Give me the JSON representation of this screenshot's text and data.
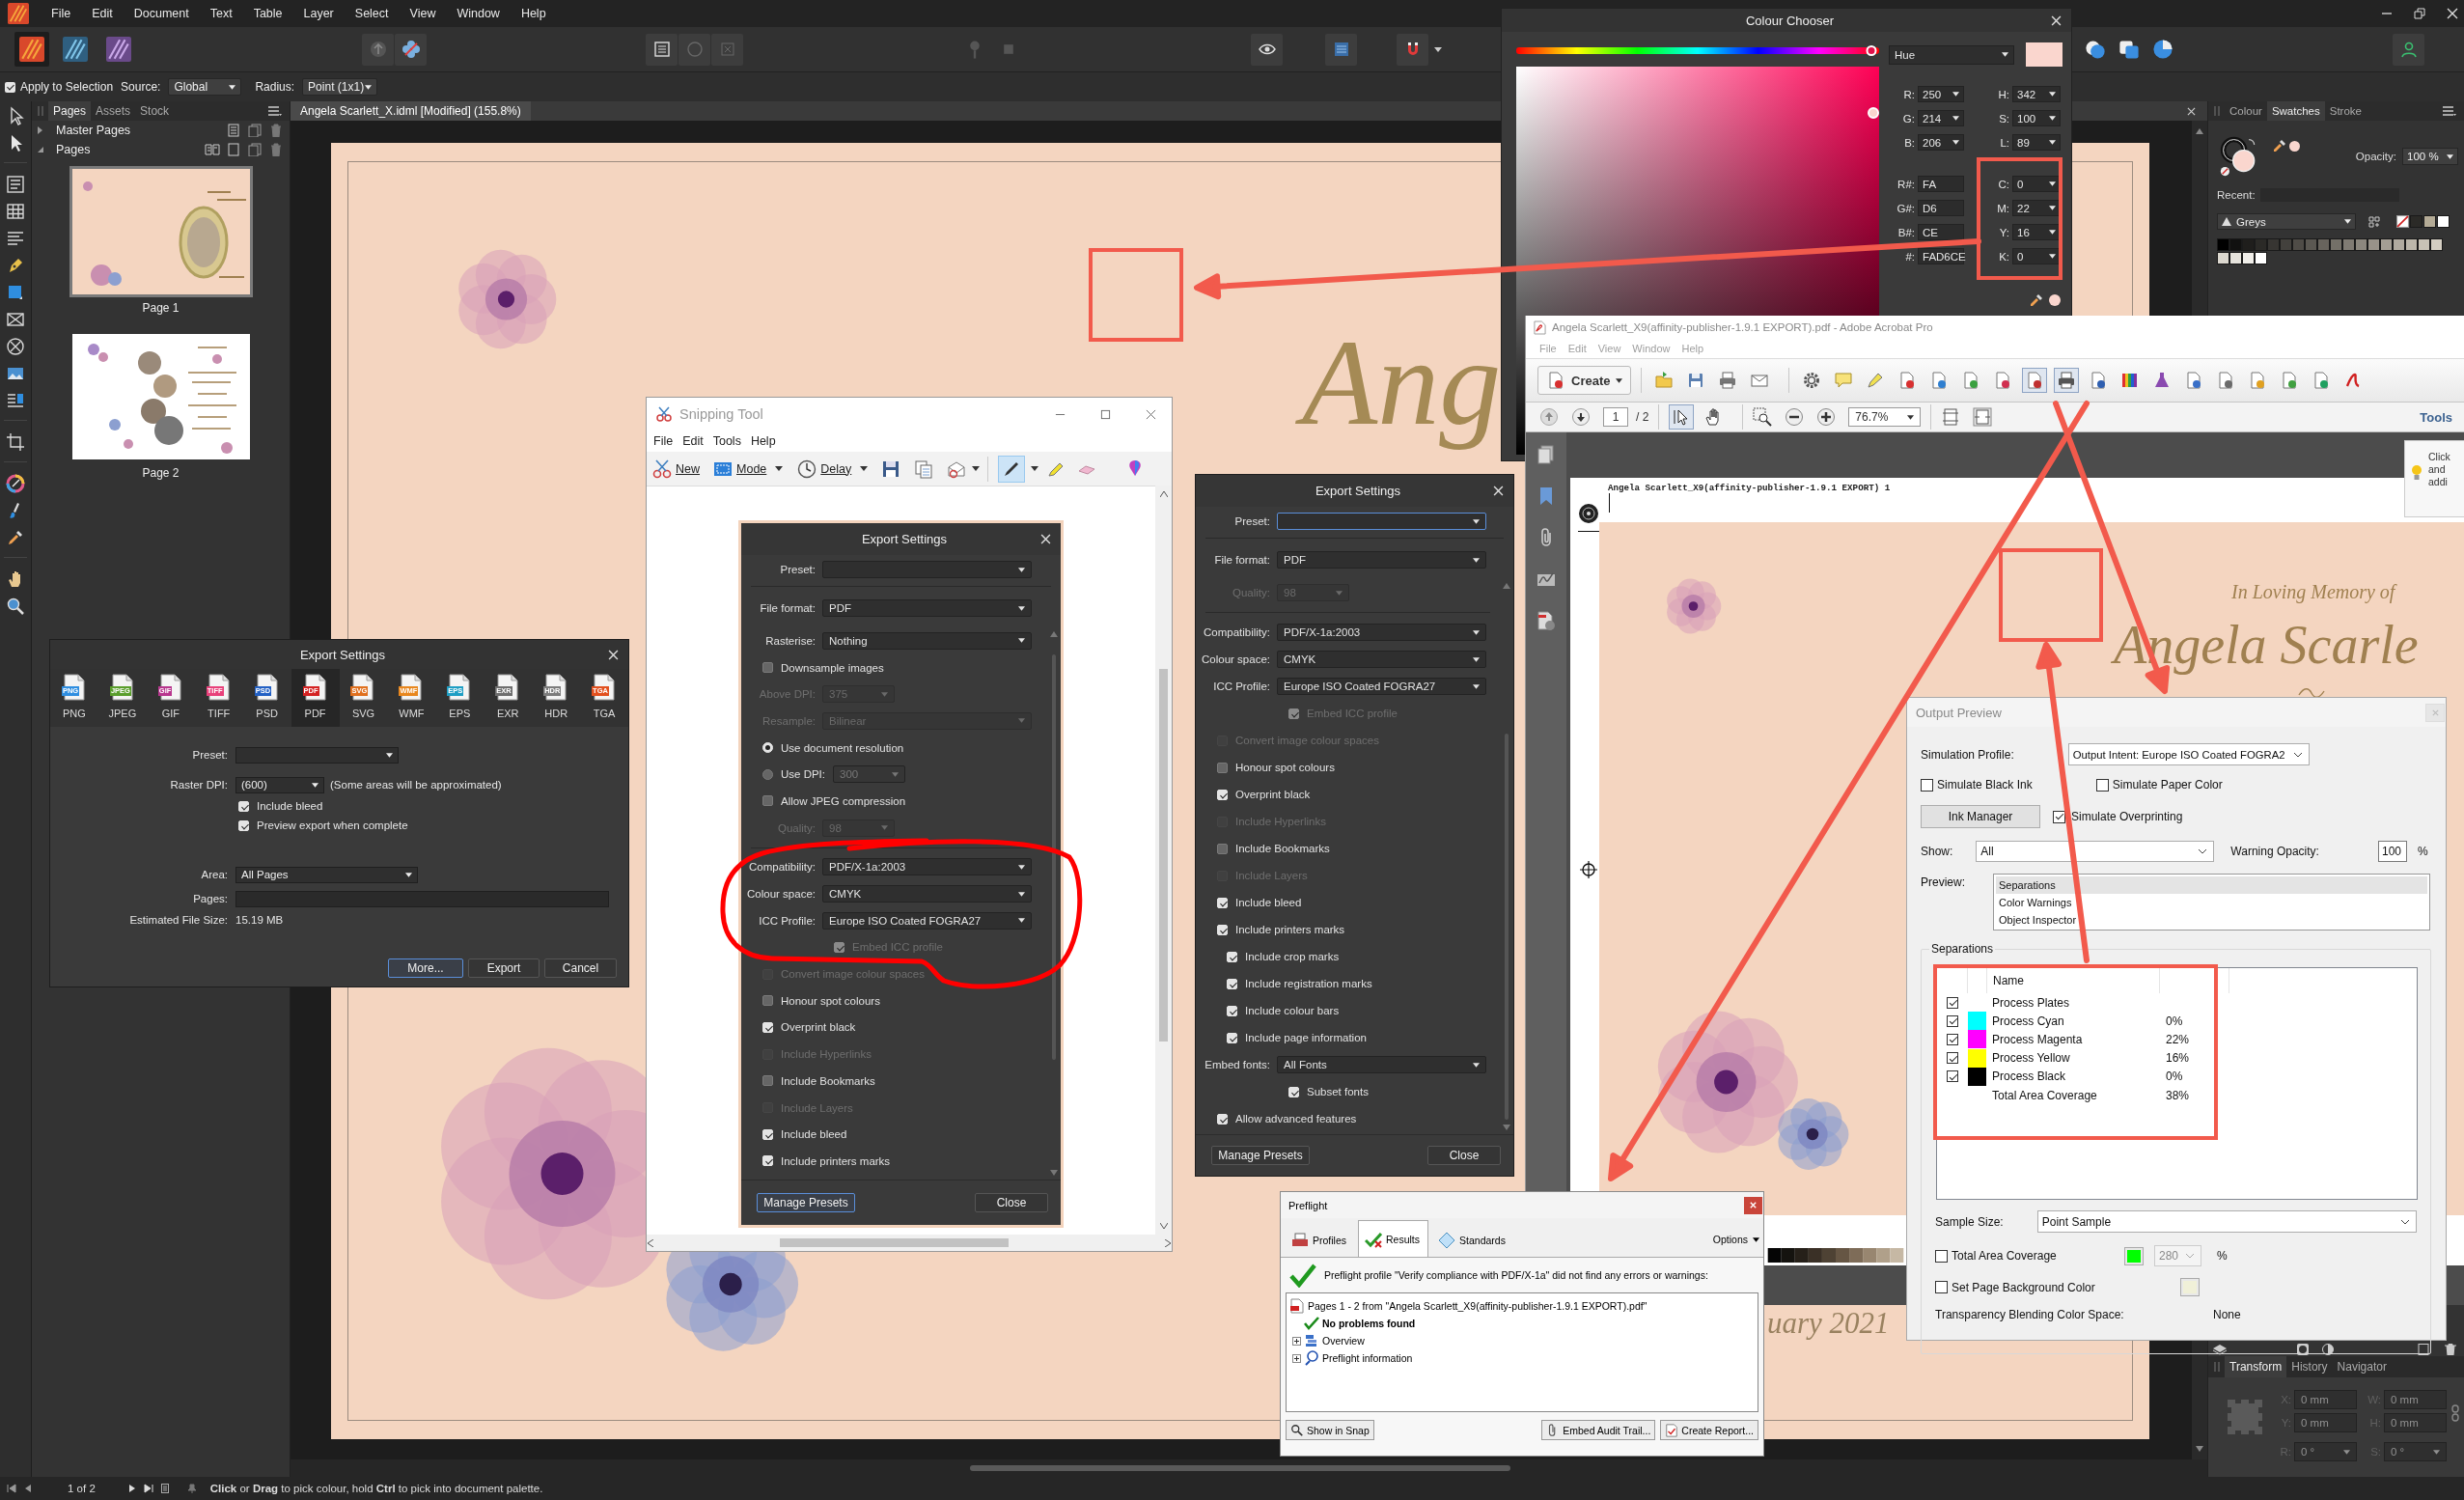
{
  "affinity": {
    "menu": [
      "File",
      "Edit",
      "Document",
      "Text",
      "Table",
      "Layer",
      "Select",
      "View",
      "Window",
      "Help"
    ],
    "personas": [
      {
        "selected": true
      },
      {
        "selected": false
      },
      {
        "selected": false
      }
    ],
    "context_bar": {
      "apply_to_selection": {
        "label": "Apply to Selection",
        "checked": true
      },
      "source": {
        "label": "Source:",
        "value": "Global"
      },
      "radius": {
        "label": "Radius:",
        "value": "Point (1x1)"
      }
    },
    "pages_panel": {
      "tabs": [
        {
          "label": "Pages",
          "selected": true
        },
        {
          "label": "Assets",
          "selected": false
        },
        {
          "label": "Stock",
          "selected": false
        }
      ],
      "sections": [
        {
          "label": "Master Pages",
          "expanded": false
        },
        {
          "label": "Pages",
          "expanded": true
        }
      ],
      "pages": [
        {
          "label": "Page 1",
          "selected": true
        },
        {
          "label": "Page 2",
          "selected": false
        }
      ]
    },
    "document_tab": "Angela Scarlett_X.idml [Modified] (155.8%)",
    "canvas_texts": [
      {
        "kind": "script",
        "text": "Ang"
      },
      {
        "kind": "date",
        "text": "uary 2021"
      }
    ],
    "studio": {
      "tabs": [
        {
          "label": "Colour",
          "selected": false
        },
        {
          "label": "Swatches",
          "selected": true
        },
        {
          "label": "Stroke",
          "selected": false
        }
      ],
      "opacity": {
        "label": "Opacity:",
        "value": "100 %"
      },
      "recent_label": "Recent:",
      "palette": "Greys",
      "document_swatches": [
        {
          "color": "#2b2a27"
        },
        {
          "color": "#b4ab96"
        },
        {
          "color": "#ffffff"
        }
      ],
      "swatches": [
        {
          "color": "#000000"
        },
        {
          "color": "#111110"
        },
        {
          "color": "#1f1e1c"
        },
        {
          "color": "#2b2a27"
        },
        {
          "color": "#373532"
        },
        {
          "color": "#43413d"
        },
        {
          "color": "#4f4c47"
        },
        {
          "color": "#5b5852"
        },
        {
          "color": "#68645d"
        },
        {
          "color": "#747068"
        },
        {
          "color": "#807b73"
        },
        {
          "color": "#8c877e"
        },
        {
          "color": "#989289"
        },
        {
          "color": "#a49e94"
        },
        {
          "color": "#b0aa9f"
        },
        {
          "color": "#bcb6aa"
        },
        {
          "color": "#c8c2b6"
        },
        {
          "color": "#d4cec2"
        },
        {
          "color": "#dcd8cf"
        },
        {
          "color": "#e6e3dc"
        },
        {
          "color": "#f0eee9"
        },
        {
          "color": "#ffffff"
        }
      ],
      "lower_tabs": [
        {
          "label": "Transform",
          "selected": true
        },
        {
          "label": "History",
          "selected": false
        },
        {
          "label": "Navigator",
          "selected": false
        }
      ],
      "transform_fields": [
        {
          "kind": "number",
          "label": "X:",
          "value": "0 mm",
          "disabled": true
        },
        {
          "kind": "number",
          "label": "W:",
          "value": "0 mm",
          "disabled": true
        },
        {
          "kind": "number",
          "label": "Y:",
          "value": "0 mm",
          "disabled": true
        },
        {
          "kind": "number",
          "label": "H:",
          "value": "0 mm",
          "disabled": true
        },
        {
          "kind": "angle",
          "label": "R:",
          "value": "0 °",
          "disabled": true
        },
        {
          "kind": "angle",
          "label": "S:",
          "value": "0 °",
          "disabled": true
        }
      ]
    },
    "status_bar": {
      "page": "1 of 2",
      "hint": "**Click** or **Drag** to pick colour, hold **Ctrl** to pick into document palette."
    }
  },
  "colour_chooser": {
    "title": "Colour Chooser",
    "hue": {
      "level": 0.98
    },
    "mode": "Hue",
    "swatch": {
      "color": "#fad6ce"
    },
    "colour_field": {
      "level": 0.88
    },
    "rgb": [
      {
        "label": "R:",
        "value": "250"
      },
      {
        "label": "G:",
        "value": "214"
      },
      {
        "label": "B:",
        "value": "206"
      }
    ],
    "hsl": [
      {
        "label": "H:",
        "value": "342"
      },
      {
        "label": "S:",
        "value": "100"
      },
      {
        "label": "L:",
        "value": "89"
      }
    ],
    "hex": [
      {
        "label": "R#:",
        "value": "FA"
      },
      {
        "label": "G#:",
        "value": "D6"
      },
      {
        "label": "B#:",
        "value": "CE"
      },
      {
        "label": "#:",
        "value": "FAD6CE"
      }
    ],
    "cmyk": [
      {
        "label": "C:",
        "value": "0"
      },
      {
        "label": "M:",
        "value": "22"
      },
      {
        "label": "Y:",
        "value": "16"
      },
      {
        "label": "K:",
        "value": "0"
      }
    ]
  },
  "export_settings_left": {
    "title": "Export Settings",
    "formats": [
      {
        "badge": "PNG",
        "label": "PNG",
        "color": "#2f8ee0",
        "selected": false
      },
      {
        "badge": "JPEG",
        "label": "JPEG",
        "color": "#5a9e2c",
        "selected": false
      },
      {
        "badge": "GIF",
        "label": "GIF",
        "color": "#b8368e",
        "selected": false
      },
      {
        "badge": "TIFF",
        "label": "TIFF",
        "color": "#e8407a",
        "selected": false
      },
      {
        "badge": "PSD",
        "label": "PSD",
        "color": "#2260c4",
        "selected": false
      },
      {
        "badge": "PDF",
        "label": "PDF",
        "color": "#d42222",
        "selected": true
      },
      {
        "badge": "SVG",
        "label": "SVG",
        "color": "#e0701e",
        "selected": false
      },
      {
        "badge": "WMF",
        "label": "WMF",
        "color": "#e8871e",
        "selected": false
      },
      {
        "badge": "EPS",
        "label": "EPS",
        "color": "#1e9ec4",
        "selected": false
      },
      {
        "badge": "EXR",
        "label": "EXR",
        "color": "#6e6e6e",
        "selected": false
      },
      {
        "badge": "HDR",
        "label": "HDR",
        "color": "#7c7c7c",
        "selected": false
      },
      {
        "badge": "TGA",
        "label": "TGA",
        "color": "#e2501e",
        "selected": false
      }
    ],
    "preset": {
      "label": "Preset:"
    },
    "raster_dpi": {
      "label": "Raster DPI:",
      "value": "(600)",
      "note": "(Some areas will be approximated)"
    },
    "options": [
      {
        "label": "Include bleed",
        "checked": true
      },
      {
        "label": "Preview export when complete",
        "checked": true
      }
    ],
    "area": {
      "label": "Area:",
      "value": "All Pages"
    },
    "pages": {
      "label": "Pages:"
    },
    "file_size": {
      "label": "Estimated File Size:",
      "value": "15.19 MB"
    },
    "buttons": [
      {
        "label": "More...",
        "focused": true
      },
      {
        "label": "Export",
        "focused": false
      },
      {
        "label": "Cancel",
        "focused": false
      }
    ]
  },
  "snipping_tool": {
    "title": "Snipping Tool",
    "menu": [
      "File",
      "Edit",
      "Tools",
      "Help"
    ],
    "toolbar": [
      {
        "kind": "new",
        "label": "New"
      },
      {
        "kind": "mode",
        "label": "Mode"
      },
      {
        "kind": "delay",
        "label": "Delay"
      }
    ],
    "drawing_tools": [
      {
        "selected": true
      },
      {
        "selected": false
      },
      {
        "selected": false
      }
    ],
    "export_settings": {
      "title": "Export Settings",
      "preset": {
        "label": "Preset:",
        "focused": false
      },
      "file_format": {
        "label": "File format:",
        "value": "PDF"
      },
      "sections": [
        {
          "rows": [
            {
              "kind": "select",
              "label": "Rasterise:",
              "value": "Nothing",
              "disabled": false
            },
            {
              "kind": "check",
              "label": "Downsample images",
              "checked": false,
              "disabled": false
            },
            {
              "kind": "number",
              "label": "Above DPI:",
              "value": "375",
              "disabled": true
            },
            {
              "kind": "select",
              "label": "Resample:",
              "value": "Bilinear",
              "disabled": true
            },
            {
              "kind": "radio",
              "label": "Use document resolution",
              "selected": true,
              "disabled": false
            },
            {
              "kind": "radio",
              "label": "Use DPI:",
              "value": "300",
              "selected": false,
              "disabled": false
            },
            {
              "kind": "check",
              "label": "Allow JPEG compression",
              "checked": false,
              "disabled": false
            },
            {
              "kind": "number",
              "label": "Quality:",
              "value": "98",
              "disabled": true
            }
          ]
        },
        {
          "rows": [
            {
              "kind": "select",
              "label": "Compatibility:",
              "value": "PDF/X-1a:2003",
              "disabled": false
            },
            {
              "kind": "select",
              "label": "Colour space:",
              "value": "CMYK",
              "disabled": false
            },
            {
              "kind": "select",
              "label": "ICC Profile:",
              "value": "Europe ISO Coated FOGRA27",
              "disabled": false,
              "children": [
                {
                  "kind": "check",
                  "label": "Embed ICC profile",
                  "checked": true,
                  "disabled": true
                }
              ]
            },
            {
              "kind": "check",
              "label": "Convert image colour spaces",
              "checked": false,
              "disabled": true
            },
            {
              "kind": "check",
              "label": "Honour spot colours",
              "checked": false,
              "disabled": false
            },
            {
              "kind": "check",
              "label": "Overprint black",
              "checked": true,
              "disabled": false
            },
            {
              "kind": "check",
              "label": "Include Hyperlinks",
              "checked": false,
              "disabled": true
            },
            {
              "kind": "check",
              "label": "Include Bookmarks",
              "checked": false,
              "disabled": false
            },
            {
              "kind": "check",
              "label": "Include Layers",
              "checked": false,
              "disabled": true
            },
            {
              "kind": "check",
              "label": "Include bleed",
              "checked": true,
              "disabled": false
            },
            {
              "kind": "check",
              "label": "Include printers marks",
              "checked": true,
              "disabled": false
            }
          ]
        }
      ],
      "buttons": [
        {
          "label": "Manage Presets",
          "focused": true
        },
        {
          "label": "Close",
          "focused": false
        }
      ]
    }
  },
  "export_settings_right": {
    "title": "Export Settings",
    "preset": {
      "label": "Preset:",
      "focused": true
    },
    "file_format": {
      "label": "File format:",
      "value": "PDF"
    },
    "sections": [
      {
        "rows": [
          {
            "kind": "number",
            "label": "Quality:",
            "value": "98",
            "disabled": true
          }
        ]
      },
      {
        "rows": [
          {
            "kind": "select",
            "label": "Compatibility:",
            "value": "PDF/X-1a:2003",
            "disabled": false
          },
          {
            "kind": "select",
            "label": "Colour space:",
            "value": "CMYK",
            "disabled": false
          },
          {
            "kind": "select",
            "label": "ICC Profile:",
            "value": "Europe ISO Coated FOGRA27",
            "disabled": false,
            "children": [
              {
                "kind": "check",
                "label": "Embed ICC profile",
                "checked": true,
                "disabled": true
              }
            ]
          },
          {
            "kind": "check",
            "label": "Convert image colour spaces",
            "checked": false,
            "disabled": true
          },
          {
            "kind": "check",
            "label": "Honour spot colours",
            "checked": false,
            "disabled": false
          },
          {
            "kind": "check",
            "label": "Overprint black",
            "checked": true,
            "disabled": false
          },
          {
            "kind": "check",
            "label": "Include Hyperlinks",
            "checked": false,
            "disabled": true
          },
          {
            "kind": "check",
            "label": "Include Bookmarks",
            "checked": false,
            "disabled": false
          },
          {
            "kind": "check",
            "label": "Include Layers",
            "checked": false,
            "disabled": true
          },
          {
            "kind": "check",
            "label": "Include bleed",
            "checked": true,
            "disabled": false
          },
          {
            "kind": "check",
            "label": "Include printers marks",
            "checked": true,
            "disabled": false,
            "children": [
              {
                "kind": "check",
                "label": "Include crop marks",
                "checked": true,
                "disabled": false
              },
              {
                "kind": "check",
                "label": "Include registration marks",
                "checked": true,
                "disabled": false
              },
              {
                "kind": "check",
                "label": "Include colour bars",
                "checked": true,
                "disabled": false
              },
              {
                "kind": "check",
                "label": "Include page information",
                "checked": true,
                "disabled": false
              }
            ]
          },
          {
            "kind": "select",
            "label": "Embed fonts:",
            "value": "All Fonts",
            "disabled": false,
            "children": [
              {
                "kind": "check",
                "label": "Subset fonts",
                "checked": true,
                "disabled": false
              }
            ]
          },
          {
            "kind": "check",
            "label": "Allow advanced features",
            "checked": true,
            "disabled": false
          }
        ]
      }
    ],
    "buttons": [
      {
        "label": "Manage Presets",
        "focused": false
      },
      {
        "label": "Close",
        "focused": false
      }
    ]
  },
  "acrobat": {
    "title": "Angela Scarlett_X9(affinity-publisher-1.9.1 EXPORT).pdf - Adobe Acrobat Pro",
    "menu": [
      "File",
      "Edit",
      "View",
      "Window",
      "Help"
    ],
    "create": "Create",
    "tool_buttons": [
      {
        "selected": false
      },
      {
        "selected": false
      },
      {
        "selected": false
      },
      {
        "selected": false
      },
      {
        "selected": false
      },
      {
        "selected": false
      },
      {
        "selected": false
      },
      {
        "selected": false
      },
      {
        "selected": false
      },
      {
        "selected": false
      },
      {
        "selected": false
      },
      {
        "selected": true
      },
      {
        "selected": true
      },
      {
        "selected": false
      },
      {
        "selected": false
      },
      {
        "selected": false
      },
      {
        "selected": false
      },
      {
        "selected": false
      },
      {
        "selected": false
      },
      {
        "selected": false
      },
      {
        "selected": false
      },
      {
        "selected": false
      }
    ],
    "page": "1",
    "page_count": "/ 2",
    "nav_tools": [
      {
        "selected": true
      },
      {
        "selected": false
      }
    ],
    "zoom": "76.7%",
    "tools": "Tools",
    "tip": "Click and addi",
    "page_header": "Angela Scarlett_X9(affinity-publisher-1.9.1 EXPORT) 1",
    "page_texts": [
      {
        "kind": "heading",
        "text": "In Loving Memory of"
      },
      {
        "kind": "script",
        "text": "Angela Scarle"
      }
    ]
  },
  "output_preview": {
    "title": "Output Preview",
    "simulation_profile": {
      "label": "Simulation Profile:",
      "value": "Output Intent: Europe ISO Coated FOGRA2"
    },
    "simulate": [
      {
        "label": "Simulate Black Ink",
        "checked": false
      },
      {
        "label": "Simulate Paper Color",
        "checked": false
      }
    ],
    "ink_manager": "Ink Manager",
    "simulate_overprinting": {
      "label": "Simulate Overprinting",
      "checked": true
    },
    "show": {
      "label": "Show:",
      "value": "All"
    },
    "warning_opacity": {
      "label": "Warning Opacity:",
      "value": "100",
      "unit": "%"
    },
    "preview": {
      "label": "Preview:",
      "items": [
        {
          "label": "Separations",
          "selected": true
        },
        {
          "label": "Color Warnings",
          "selected": false
        },
        {
          "label": "Object Inspector",
          "selected": false
        }
      ]
    },
    "separations": {
      "title": "Separations",
      "column": "Name",
      "plates": [
        {
          "kind": "group",
          "name": "Process Plates",
          "checked": true
        },
        {
          "kind": "ink",
          "name": "Process Cyan",
          "checked": true,
          "color": "#00ffff",
          "coverage": "0%"
        },
        {
          "kind": "ink",
          "name": "Process Magenta",
          "checked": true,
          "color": "#ff00ff",
          "coverage": "22%"
        },
        {
          "kind": "ink",
          "name": "Process Yellow",
          "checked": true,
          "color": "#ffff00",
          "coverage": "16%"
        },
        {
          "kind": "ink",
          "name": "Process Black",
          "checked": true,
          "color": "#000000",
          "coverage": "0%"
        }
      ],
      "total": {
        "name": "Total Area Coverage",
        "coverage": "38%"
      }
    },
    "sample_size": {
      "label": "Sample Size:",
      "value": "Point Sample"
    },
    "total_area_coverage": {
      "label": "Total Area Coverage",
      "checked": false,
      "color": "#00ff00",
      "value": "280",
      "unit": "%"
    },
    "page_background": {
      "label": "Set Page Background Color",
      "checked": false,
      "color": "#f0f0d8"
    },
    "blending": {
      "label": "Transparency Blending Color Space:",
      "value": "None"
    }
  },
  "preflight": {
    "title": "Preflight",
    "tabs": [
      {
        "label": "Profiles",
        "selected": false
      },
      {
        "label": "Results",
        "selected": true
      },
      {
        "label": "Standards",
        "selected": false
      }
    ],
    "options": "Options",
    "message": "Preflight profile \"Verify compliance with PDF/X-1a\" did not find any errors or warnings:",
    "tree": [
      {
        "kind": "file",
        "label": "Pages 1 - 2 from \"Angela Scarlett_X9(affinity-publisher-1.9.1 EXPORT).pdf\"",
        "children": [
          {
            "kind": "ok",
            "label": "No problems found"
          },
          {
            "kind": "overview",
            "label": "Overview",
            "expanded": false
          },
          {
            "kind": "info",
            "label": "Preflight information",
            "expanded": false
          }
        ]
      }
    ],
    "buttons": [
      "Show in Snap",
      "Embed Audit Trail...",
      "Create Report..."
    ]
  }
}
